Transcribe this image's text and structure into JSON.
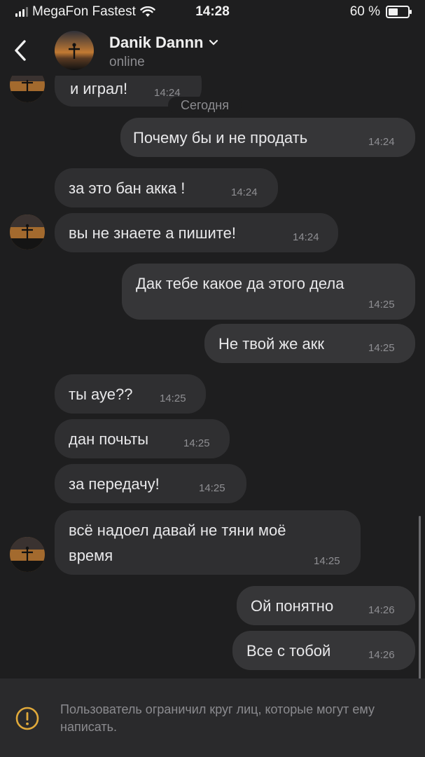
{
  "status_bar": {
    "carrier": "MegaFon Fastest",
    "time": "14:28",
    "battery": "60 %",
    "battery_level": 0.6
  },
  "header": {
    "contact_name": "Danik Dannn",
    "status": "online"
  },
  "date_separator": "Сегодня",
  "messages": [
    {
      "direction": "in",
      "text": "и играл!",
      "time": "14:24"
    },
    {
      "direction": "out",
      "text": "Почему бы и не продать",
      "time": "14:24"
    },
    {
      "direction": "in",
      "text": "за это бан акка !",
      "time": "14:24"
    },
    {
      "direction": "in",
      "text": "вы не знаете а пишите!",
      "time": "14:24"
    },
    {
      "direction": "out",
      "text": "Дак тебе какое да этого дела",
      "time": "14:25"
    },
    {
      "direction": "out",
      "text": "Не твой же акк",
      "time": "14:25"
    },
    {
      "direction": "in",
      "text": "ты ауе??",
      "time": "14:25"
    },
    {
      "direction": "in",
      "text": "дан почьты",
      "time": "14:25"
    },
    {
      "direction": "in",
      "text": "за передачу!",
      "time": "14:25"
    },
    {
      "direction": "in",
      "text_line1": "всё надоел давай не тяни моё",
      "text_line2": "время",
      "time": "14:25"
    },
    {
      "direction": "out",
      "text": "Ой понятно",
      "time": "14:26"
    },
    {
      "direction": "out",
      "text": "Все с тобой",
      "time": "14:26"
    }
  ],
  "footer": {
    "notice": "Пользователь ограничил круг лиц, которые могут ему написать.",
    "icon": "warning-icon"
  },
  "colors": {
    "background": "#1e1e1f",
    "bubble": "#363638",
    "warning": "#e0a93a"
  }
}
